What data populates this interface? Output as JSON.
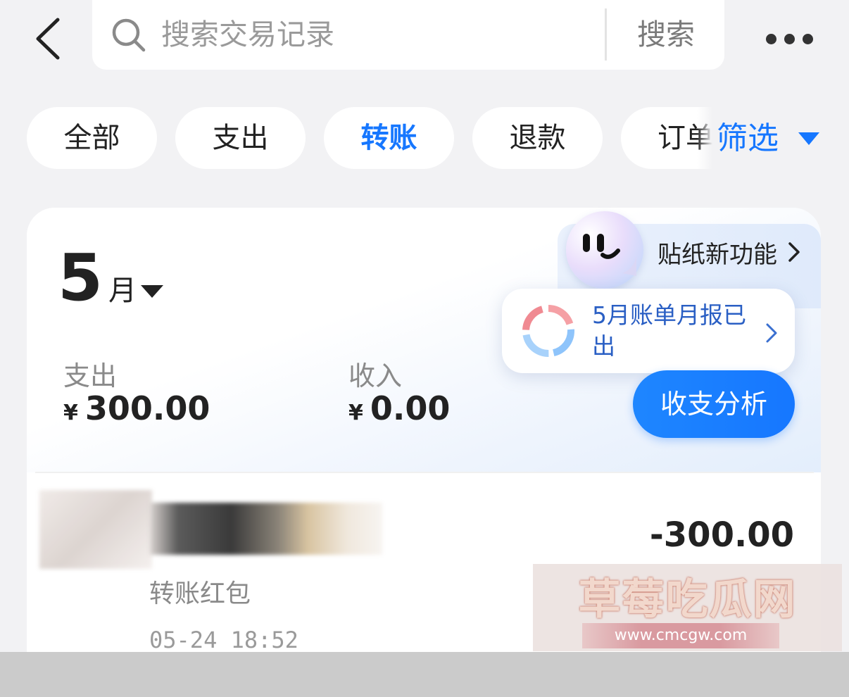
{
  "search": {
    "placeholder": "搜索交易记录",
    "button_label": "搜索"
  },
  "tabs": [
    {
      "label": "全部",
      "active": false
    },
    {
      "label": "支出",
      "active": false
    },
    {
      "label": "转账",
      "active": true
    },
    {
      "label": "退款",
      "active": false
    },
    {
      "label": "订单",
      "active": false
    }
  ],
  "filter": {
    "label": "筛选"
  },
  "summary": {
    "month": "5",
    "month_unit": "月",
    "expense_label": "支出",
    "expense_currency": "¥",
    "expense_value": "300.00",
    "income_label": "收入",
    "income_currency": "¥",
    "income_value": "0.00"
  },
  "sticker_banner": {
    "label": "贴纸新功能"
  },
  "report_popup": {
    "text": "5月账单月报已出"
  },
  "analysis_button": {
    "label": "收支分析"
  },
  "transactions": [
    {
      "amount": "-300.00",
      "description": "转账红包",
      "time": "05-24 18:52"
    }
  ],
  "watermark": {
    "title": "草莓吃瓜网",
    "url": "www.cmcgw.com"
  },
  "colors": {
    "accent": "#1677ff",
    "background": "#f2f2f4",
    "card": "#ffffff",
    "muted_text": "#8a8a8a"
  },
  "icons": [
    "back-arrow-icon",
    "search-icon",
    "more-icon",
    "caret-down-icon",
    "chevron-right-icon",
    "donut-chart-icon",
    "sticker-face-icon"
  ]
}
